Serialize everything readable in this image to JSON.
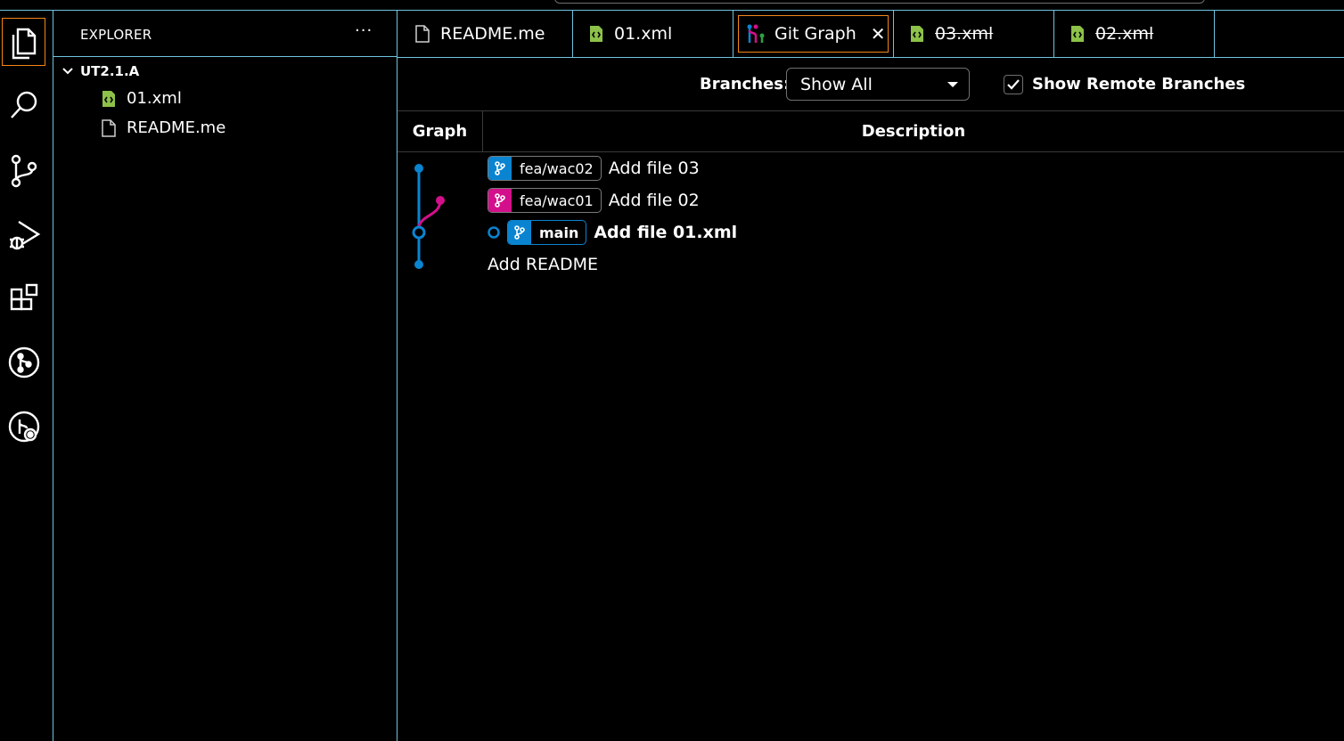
{
  "activity_bar": {
    "items": [
      {
        "icon": "files-icon",
        "active": true
      },
      {
        "icon": "search-icon"
      },
      {
        "icon": "source-control-icon"
      },
      {
        "icon": "run-debug-icon"
      },
      {
        "icon": "extensions-icon"
      },
      {
        "icon": "git-graph-icon"
      },
      {
        "icon": "git-remote-icon"
      }
    ]
  },
  "sidebar": {
    "title": "EXPLORER",
    "more": "···",
    "folder": "UT2.1.A",
    "files": [
      {
        "name": "01.xml",
        "icon": "xml-file-icon"
      },
      {
        "name": "README.me",
        "icon": "file-icon"
      }
    ]
  },
  "tabs": [
    {
      "label": "README.me",
      "icon": "file-icon",
      "active": false,
      "deleted": false
    },
    {
      "label": "01.xml",
      "icon": "xml-file-icon",
      "active": false,
      "deleted": false
    },
    {
      "label": "Git Graph",
      "icon": "git-graph-icon",
      "active": true,
      "close": "✕"
    },
    {
      "label": "03.xml",
      "icon": "xml-file-icon",
      "active": false,
      "deleted": true
    },
    {
      "label": "02.xml",
      "icon": "xml-file-icon",
      "active": false,
      "deleted": true
    }
  ],
  "git_graph": {
    "branches_label": "Branches:",
    "branches_value": "Show All",
    "show_remote_label": "Show Remote Branches",
    "show_remote_checked": true,
    "columns": {
      "graph": "Graph",
      "description": "Description"
    },
    "commits": [
      {
        "ref": "fea/wac02",
        "ref_color": "#0a84d0",
        "message": "Add file 03"
      },
      {
        "ref": "fea/wac01",
        "ref_color": "#d40f8b",
        "message": "Add file 02"
      },
      {
        "ref": "main",
        "ref_color": "#0a84d0",
        "message": "Add file 01.xml",
        "head": true
      },
      {
        "message": "Add README"
      }
    ]
  },
  "colors": {
    "accent_border": "#6fc3df",
    "active_outline": "#f38518",
    "branch_blue": "#0a84d0",
    "branch_pink": "#d40f8b",
    "xml_green": "#8dc149"
  }
}
